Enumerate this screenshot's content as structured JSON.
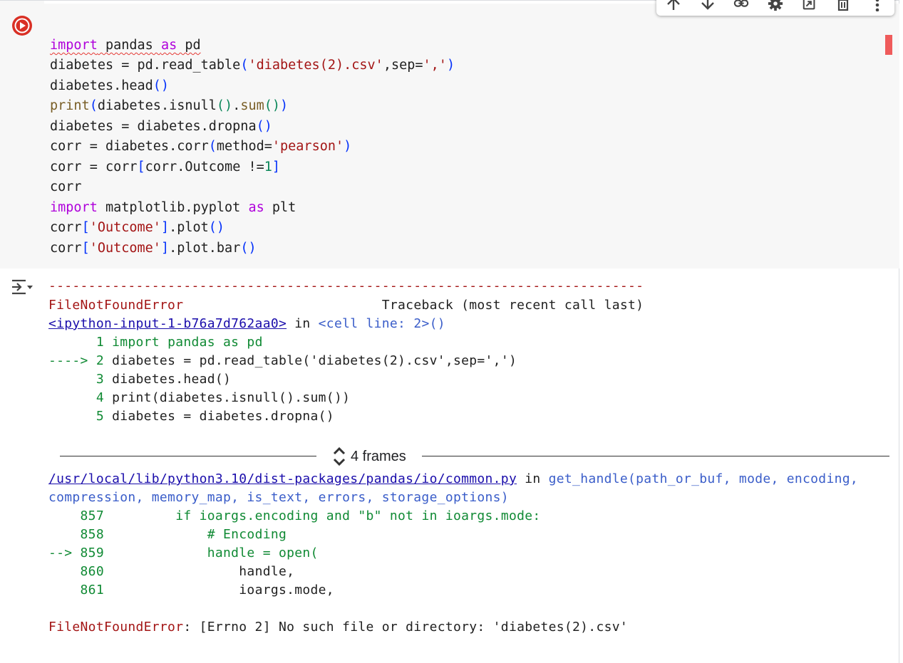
{
  "toolbar": {
    "icons": [
      "move-up-icon",
      "move-down-icon",
      "link-icon",
      "settings-icon",
      "mirror-cell-icon",
      "delete-icon",
      "more-icon"
    ]
  },
  "cell": {
    "run_icon": "play-icon",
    "code_lines": [
      "import pandas as pd",
      "diabetes = pd.read_table('diabetes(2).csv',sep=',')",
      "diabetes.head()",
      "print(diabetes.isnull().sum())",
      "diabetes = diabetes.dropna()",
      "corr = diabetes.corr(method='pearson')",
      "corr = corr[corr.Outcome !=1]",
      "corr",
      "import matplotlib.pyplot as plt",
      "corr['Outcome'].plot()",
      "corr['Outcome'].plot.bar()"
    ]
  },
  "output": {
    "toggle_icon": "output-toggle-icon",
    "separator": "---------------------------------------------------------------------------",
    "error_name": "FileNotFoundError",
    "traceback_header": "Traceback (most recent call last)",
    "frame1": {
      "link": "<ipython-input-1-b76a7d762aa0>",
      "in_text": " in ",
      "location": "<cell line: 2>()",
      "lines": [
        {
          "prefix": "      1",
          "code": " import pandas as pd"
        },
        {
          "prefix": "----> 2",
          "code": " diabetes = pd.read_table('diabetes(2).csv',sep=',')"
        },
        {
          "prefix": "      3",
          "code": " diabetes.head()"
        },
        {
          "prefix": "      4",
          "code": " print(diabetes.isnull().sum())"
        },
        {
          "prefix": "      5",
          "code": " diabetes = diabetes.dropna()"
        }
      ]
    },
    "frames_label": "4 frames",
    "frame2": {
      "link": "/usr/local/lib/python3.10/dist-packages/pandas/io/common.py",
      "in_text": " in ",
      "func": "get_handle",
      "args_line1": "(path_or_buf, mode, encoding,",
      "args_line2": "compression, memory_map, is_text, errors, storage_options)",
      "lines": [
        {
          "prefix": "    857",
          "code": "         if ioargs.encoding and \"b\" not in ioargs.mode:"
        },
        {
          "prefix": "    858",
          "code": "             # Encoding"
        },
        {
          "prefix": "--> 859",
          "code": "             handle = open("
        },
        {
          "prefix": "    860",
          "code": "                 handle,"
        },
        {
          "prefix": "    861",
          "code": "                 ioargs.mode,"
        }
      ]
    },
    "final_error_name": "FileNotFoundError",
    "final_error_msg": ": [Errno 2] No such file or directory: 'diabetes(2).csv'"
  }
}
